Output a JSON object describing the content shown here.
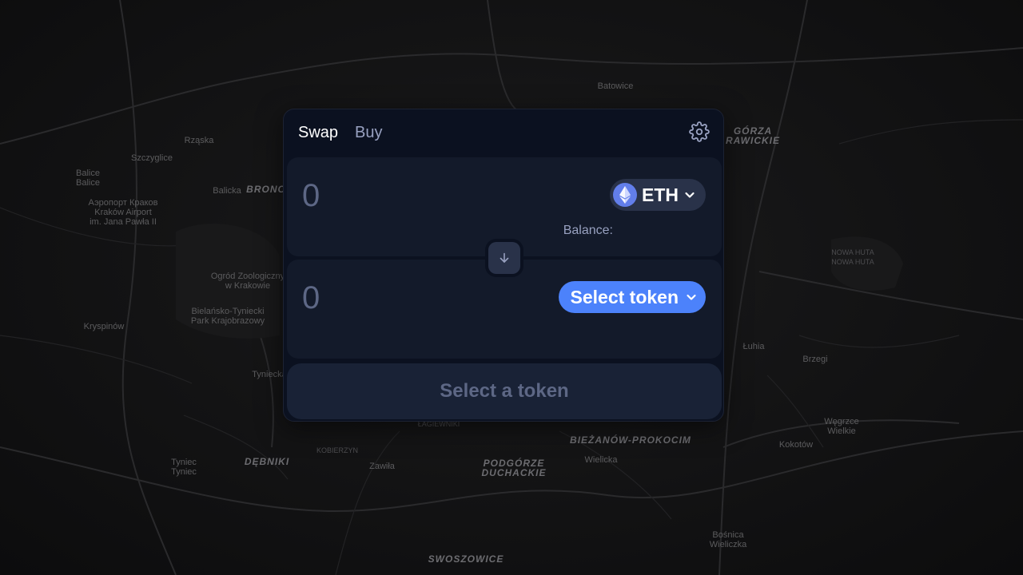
{
  "map": {
    "labels": {
      "batowice": "Batowice",
      "rzaska": "Rząska",
      "szczyglice": "Szczyglice",
      "balice": "Balice\nBalice",
      "airport": "Аэропорт Краков\nKraków Airport\nim. Jana Pawła II",
      "balicka": "Balicka",
      "bronowice": "BRONO",
      "zoo": "Ogród Zoologiczny\nw Krakowie",
      "bielansko": "Bielańsko-Tyniecki\nPark Krajobrazowy",
      "kryspinow": "Kryspinów",
      "tyniecka": "Tyniecka",
      "debniki": "DĘBNIKI",
      "kobierzyn": "KOBIERZYN",
      "zawila": "Zawiła",
      "podgorze": "PODGÓRZE\nDUCHACKIE",
      "biezanow": "BIEŻANÓW-PROKOCIM",
      "wielicka": "Wielicka",
      "swoszowice": "SWOSZOWICE",
      "lagiewniki": "ŁAGIEWNIKI",
      "gorza": "GÓRZA\nRAWICKIE",
      "luzhia": "Łuhia",
      "brzegi": "Brzegi",
      "kokotow": "Kokotów",
      "wegrzce": "Węgrzce\nWielkie",
      "nowahuta": "NOWA HUTA\nNOWA HUTA",
      "tyniec": "Tyniec\nTyniec",
      "bosnica": "Bośnica\nWieliczka"
    }
  },
  "widget": {
    "tabs": [
      "Swap",
      "Buy"
    ],
    "settings_icon": "gear-icon",
    "input": {
      "amount": "0",
      "token_symbol": "ETH",
      "balance_label": "Balance:"
    },
    "output": {
      "amount": "0",
      "select_label": "Select token"
    },
    "cta_label": "Select a token",
    "colors": {
      "background": "#0b1120",
      "panel": "#131a2a",
      "accent": "#4c82fb",
      "eth_logo": "#627eea",
      "muted_text": "#5d6785"
    }
  }
}
